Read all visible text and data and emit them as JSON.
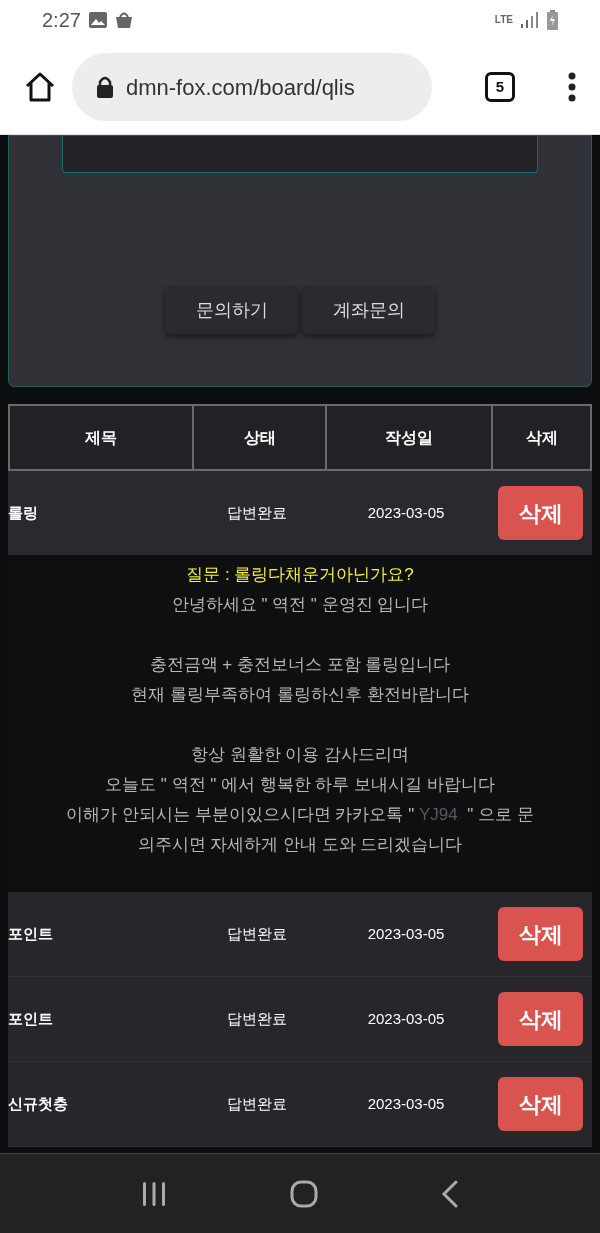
{
  "status_bar": {
    "time": "2:27",
    "network": "LTE"
  },
  "browser": {
    "url": "dmn-fox.com/board/qlis",
    "tab_count": "5"
  },
  "form": {
    "buttons": [
      "문의하기",
      "계좌문의"
    ]
  },
  "table": {
    "columns": [
      "제목",
      "상태",
      "작성일",
      "삭제"
    ],
    "rows": [
      {
        "title": "롤링",
        "status": "답변완료",
        "date": "2023-03-05",
        "action": "삭제",
        "expanded": true,
        "answer": {
          "question": "질문 : 롤링다채운거아닌가요?",
          "paragraphs": [
            [
              [
                {
                  "text": "안녕하세요 \" 역전 \" 운영진 입니다",
                  "dim": false
                }
              ]
            ],
            [
              [
                {
                  "text": "충전금액 + 충전보너스 포함 롤링입니다",
                  "dim": false
                }
              ],
              [
                {
                  "text": "현재 롤링부족하여 롤링하신후 환전바랍니다",
                  "dim": false
                }
              ]
            ],
            [
              [
                {
                  "text": "항상 원활한 이용 감사드리며",
                  "dim": false
                }
              ],
              [
                {
                  "text": "오늘도 \" 역전 \" 에서 행복한 하루 보내시길 바랍니다",
                  "dim": false
                }
              ],
              [
                {
                  "text": "이해가 안되시는 부분이있으시다면 카카오톡 \" ",
                  "dim": false
                },
                {
                  "text": "YJ94",
                  "dim": true
                },
                {
                  "text": "  \" 으로 문",
                  "dim": false
                }
              ],
              [
                {
                  "text": "의주시면 자세하게 안내 도와 드리겠습니다",
                  "dim": false
                }
              ]
            ]
          ]
        }
      },
      {
        "title": "포인트",
        "status": "답변완료",
        "date": "2023-03-05",
        "action": "삭제",
        "expanded": false
      },
      {
        "title": "포인트",
        "status": "답변완료",
        "date": "2023-03-05",
        "action": "삭제",
        "expanded": false
      },
      {
        "title": "신규첫충",
        "status": "답변완료",
        "date": "2023-03-05",
        "action": "삭제",
        "expanded": false
      }
    ]
  }
}
